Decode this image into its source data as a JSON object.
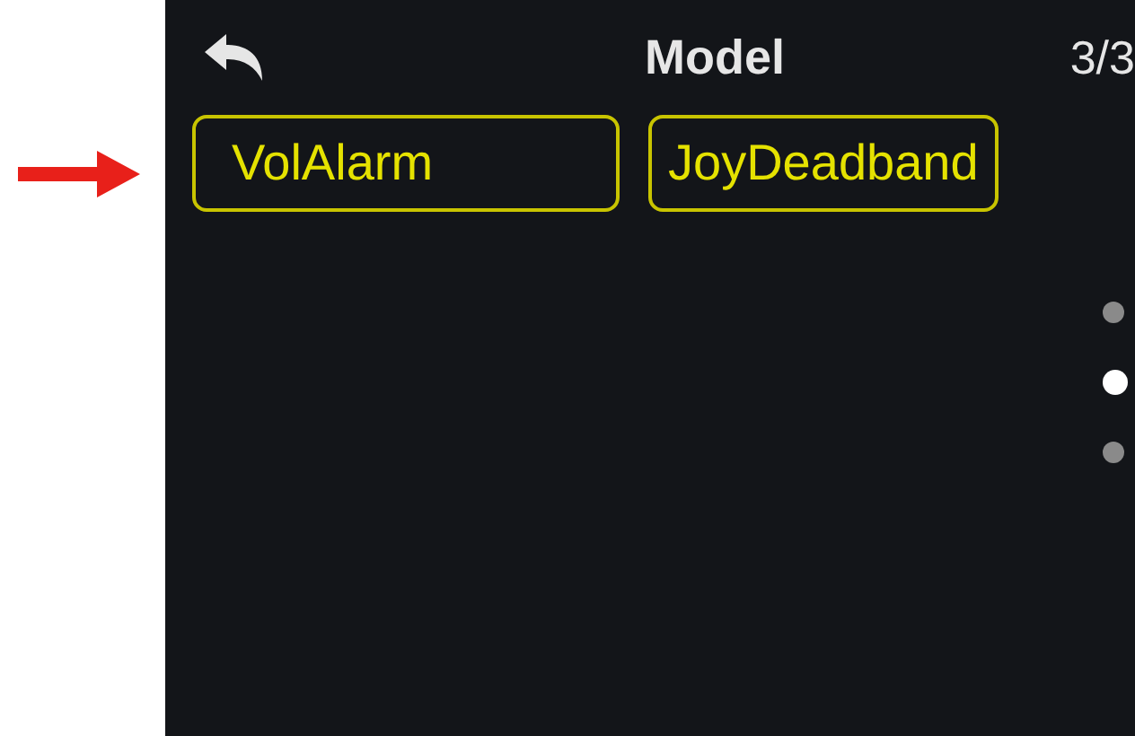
{
  "header": {
    "title": "Model",
    "page": "3/3"
  },
  "buttons": [
    {
      "label": "VolAlarm"
    },
    {
      "label": "JoyDeadband"
    }
  ],
  "page_dots": [
    {
      "selected": false
    },
    {
      "selected": true
    },
    {
      "selected": false
    }
  ]
}
